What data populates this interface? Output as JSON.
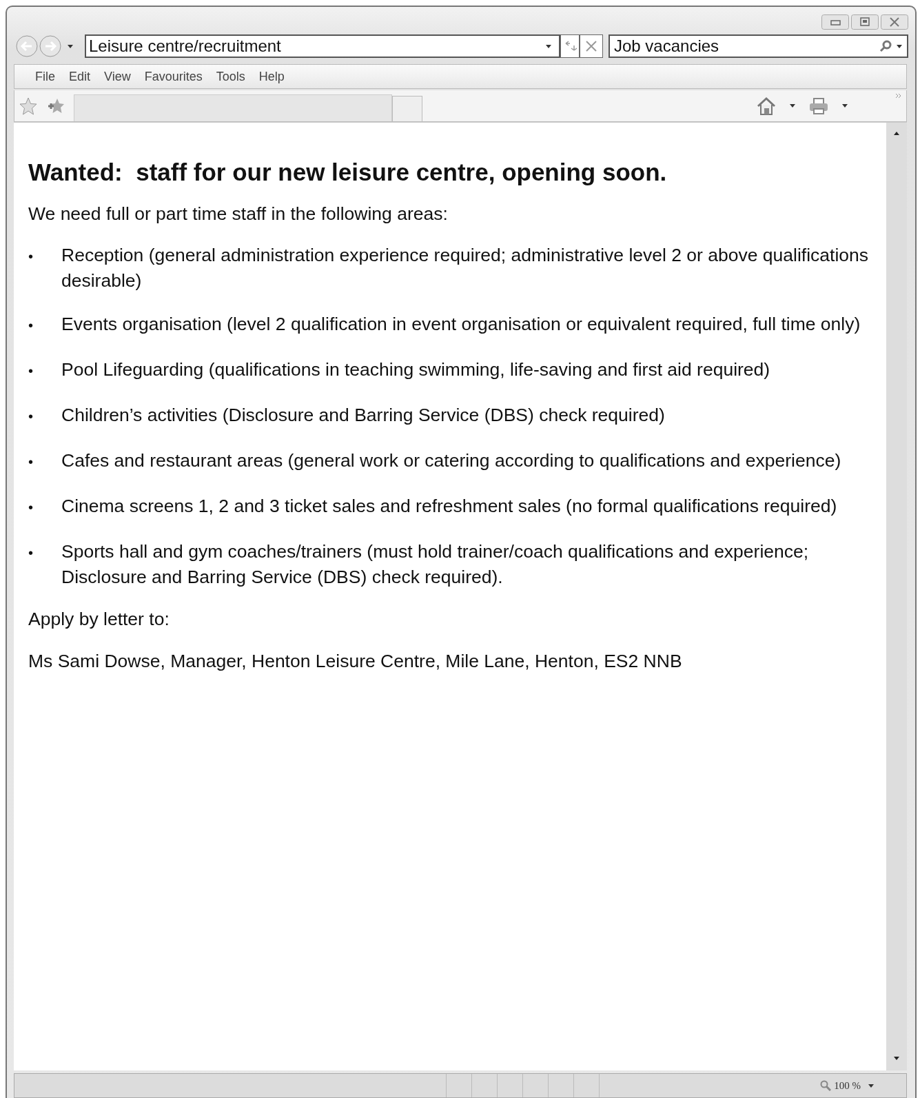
{
  "address_bar": {
    "value": "Leisure centre/recruitment"
  },
  "search_box": {
    "value": "Job vacancies"
  },
  "menu_bar": [
    "File",
    "Edit",
    "View",
    "Favourites",
    "Tools",
    "Help"
  ],
  "page": {
    "heading": "Wanted:  staff for our new leisure centre, opening soon.",
    "intro": "We need full or part time staff in the following areas:",
    "items": [
      "Reception (general administration experience required; administrative level 2 or above qualifications desirable)",
      "Events organisation (level 2 qualification in event organisation or equivalent required, full time only)",
      "Pool Lifeguarding (qualifications in teaching swimming, life-saving and first aid required)",
      "Children’s activities (Disclosure and Barring Service (DBS) check required)",
      "Cafes and restaurant areas (general work or catering according to qualifications and experience)",
      "Cinema screens 1, 2 and 3 ticket sales and refreshment sales (no formal qualifications required)",
      "Sports hall and gym coaches/trainers (must hold trainer/coach qualifications and experience; Disclosure and Barring Service (DBS) check required)."
    ],
    "bullet": "•",
    "apply": "Apply by letter to:",
    "address": "Ms Sami Dowse, Manager, Henton Leisure Centre, Mile Lane, Henton, ES2 NNB"
  },
  "status_bar": {
    "zoom": "100 %"
  }
}
